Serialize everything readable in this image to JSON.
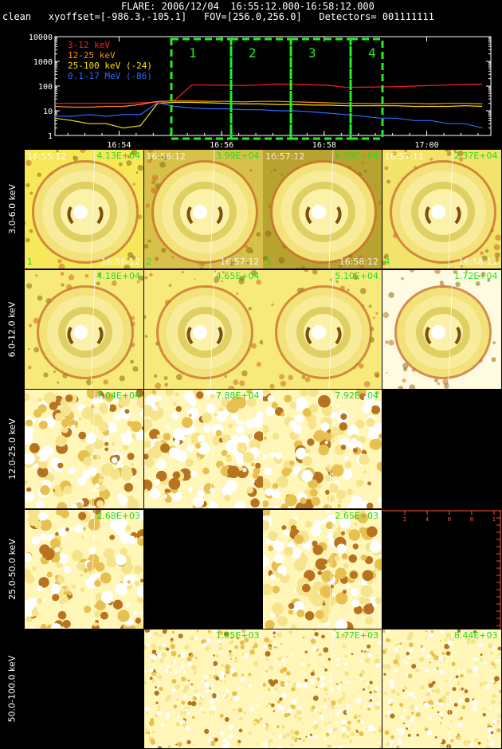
{
  "header": {
    "line1": "FLARE: 2006/12/04  16:55:12.000-16:58:12.000",
    "line2": "clean   xyoffset=[-986.3,-105.1]   FOV=[256.0,256.0]   Detectors= 001111111"
  },
  "chart_data": [
    {
      "type": "line",
      "title": "",
      "yscale": "log",
      "ylim": [
        1,
        10000
      ],
      "yticks": [
        "10000",
        "1000",
        "100",
        "10",
        "1"
      ],
      "xticks": [
        "16:54",
        "16:56",
        "16:58",
        "17:00"
      ],
      "x": [
        "16:52:45",
        "16:53:05",
        "16:53:25",
        "16:53:45",
        "16:54:05",
        "16:54:25",
        "16:54:45",
        "16:55:05",
        "16:55:25",
        "16:55:45",
        "16:56:05",
        "16:56:25",
        "16:56:45",
        "16:57:05",
        "16:57:25",
        "16:57:45",
        "16:58:05",
        "16:58:25",
        "16:58:45",
        "16:59:05",
        "16:59:25",
        "16:59:45",
        "17:00:05",
        "17:00:25",
        "17:00:45",
        "17:01:05"
      ],
      "series": [
        {
          "name": "3-12 keV",
          "color": "#ff2020",
          "values": [
            20,
            20,
            20,
            20,
            20,
            21,
            22,
            26,
            110,
            110,
            108,
            106,
            110,
            120,
            118,
            112,
            108,
            88,
            90,
            92,
            95,
            100,
            105,
            110,
            115,
            120
          ]
        },
        {
          "name": "12-25 keV",
          "color": "#ff8c1a",
          "values": [
            15,
            14,
            14,
            15,
            15,
            18,
            24,
            25,
            25,
            24,
            24,
            23,
            24,
            24,
            23,
            22,
            21,
            20,
            20,
            19,
            20,
            20,
            19,
            20,
            20,
            19
          ]
        },
        {
          "name": "25-100 keV (-24)",
          "color": "#ffe000",
          "values": [
            5,
            4,
            3,
            3,
            2,
            2.5,
            20,
            22,
            22,
            21,
            20,
            19,
            19,
            18,
            18,
            17,
            17,
            16,
            16,
            16,
            16,
            15,
            15,
            15,
            16,
            15
          ]
        },
        {
          "name": "0.1-17 MeV (-86)",
          "color": "#2a6bff",
          "values": [
            6,
            6,
            7,
            6,
            7,
            7,
            21,
            15,
            13,
            12,
            12,
            11,
            11,
            10,
            10,
            9,
            8,
            7,
            6,
            5,
            5,
            4,
            4,
            3,
            3,
            2
          ]
        }
      ],
      "intervals": [
        "1",
        "2",
        "3",
        "4"
      ]
    },
    {
      "type": "heatmap",
      "rows": [
        "3.0-6.0 keV",
        "6.0-12.0 keV",
        "12.0-25.0 keV",
        "25.0-50.0 keV",
        "50.0-100.0 keV"
      ],
      "cells": [
        [
          {
            "flux": "4.13E+04",
            "t_start": "16:55:12",
            "t_end": "16:56:12",
            "interval": "1",
            "kind": "ring"
          },
          {
            "flux": "3.99E+04",
            "t_start": "16:56:12",
            "t_end": "16:57:12",
            "interval": "2",
            "kind": "ring"
          },
          {
            "flux": "2.99E+04",
            "t_start": "16:57:12",
            "t_end": "16:58:12",
            "interval": "3",
            "kind": "ring"
          },
          {
            "flux": "2.37E+04",
            "t_start": "16:57:11",
            "t_end": "16:58:11",
            "interval": "4",
            "kind": "ring"
          }
        ],
        [
          {
            "flux": "4.18E+04",
            "kind": "ring2"
          },
          {
            "flux": "4.65E+04",
            "kind": "ring2"
          },
          {
            "flux": "5.10E+04",
            "kind": "ring2"
          },
          {
            "flux": "1.72E+04",
            "kind": "ring2"
          }
        ],
        [
          {
            "flux": "7.04E+04",
            "kind": "noise"
          },
          {
            "flux": "7.88E+04",
            "kind": "noise"
          },
          {
            "flux": "7.92E+04",
            "kind": "noise"
          },
          {
            "flux": "",
            "kind": "blank"
          }
        ],
        [
          {
            "flux": "2.68E+03",
            "kind": "noise"
          },
          {
            "flux": "",
            "kind": "blank"
          },
          {
            "flux": "2.65E+03",
            "kind": "noise"
          },
          {
            "flux": "",
            "kind": "blank",
            "ruler": [
              "2",
              "4",
              "6",
              "8",
              "1"
            ]
          }
        ],
        [
          {
            "flux": "",
            "kind": "blank"
          },
          {
            "flux": "1.85E+03",
            "kind": "fine"
          },
          {
            "flux": "1.77E+03",
            "kind": "fine"
          },
          {
            "flux": "8.44E+03",
            "kind": "fine"
          }
        ]
      ]
    }
  ]
}
